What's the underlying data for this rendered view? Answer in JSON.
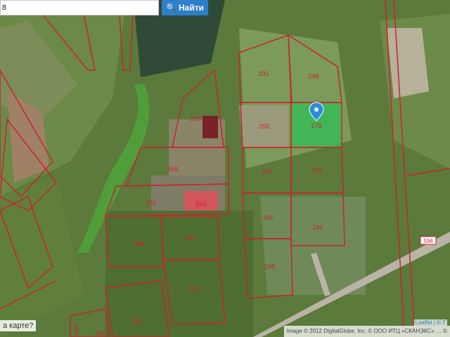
{
  "search": {
    "value": "8",
    "button_label": "Найти"
  },
  "ask_label": "а карте?",
  "attribution": "Image © 2012 DigitalGlobe, Inc. © ООО ИТЦ «СКАНЭКС» … ©",
  "leaflet_label": "Leaflet | © T",
  "plots": [
    "291",
    "299",
    "290",
    "292",
    "278",
    "293",
    "297",
    "566",
    "551",
    "564",
    "294",
    "296",
    "286",
    "287",
    "295",
    "313",
    "285",
    "284",
    "284"
  ],
  "road_label": "596",
  "colors": {
    "parcel_border": "#c9252d",
    "selected_plot": "#2fbf55",
    "marker": "#2d8cd9",
    "water": "#4f9e3a"
  }
}
